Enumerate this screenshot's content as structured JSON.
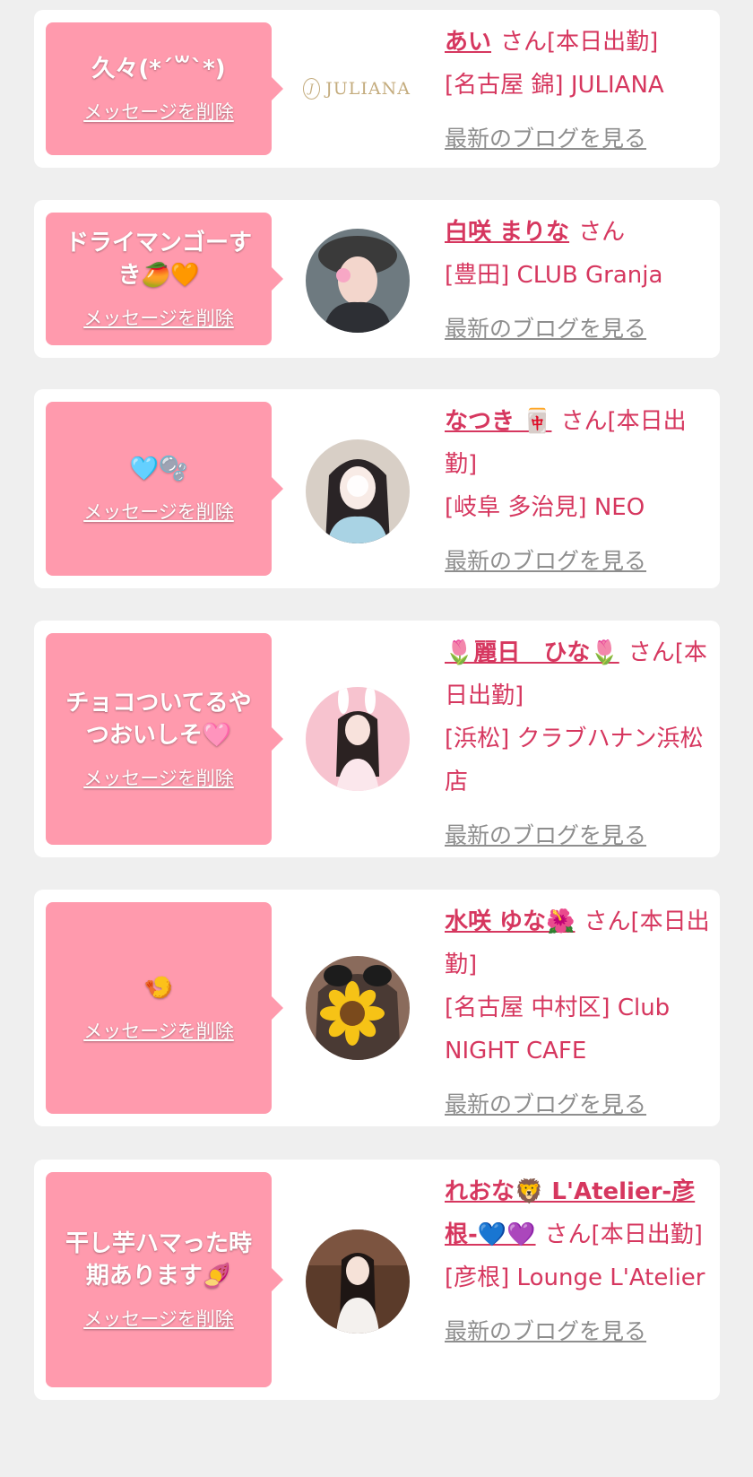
{
  "delete_label": "メッセージを削除",
  "blog_label": "最新のブログを見る",
  "colors": {
    "bubble": "#ff9aad",
    "accent": "#d6375f",
    "muted": "#8e8e8e",
    "page_bg": "#efefef"
  },
  "entries": [
    {
      "message": "久々(*´꒳`*)",
      "name": "あい",
      "suffix": "さん[本日出勤]",
      "store": "[名古屋 錦] JULIANA",
      "avatar": {
        "kind": "logo",
        "text": "JULIANA"
      }
    },
    {
      "message": "ドライマンゴーすき🥭🧡",
      "name": "白咲 まりな",
      "suffix": "さん",
      "store": "[豊田] CLUB Granja",
      "avatar": {
        "kind": "photo",
        "icon": "portrait-photo"
      }
    },
    {
      "message": "🩵🫧",
      "name": "なつき 🀄",
      "suffix": "さん[本日出勤]",
      "store": "[岐阜 多治見] NEO",
      "avatar": {
        "kind": "photo",
        "icon": "portrait-photo"
      }
    },
    {
      "message": "チョコついてるやつおいしそ🩷",
      "name": "🌷麗日　ひな🌷",
      "suffix": "さん[本日出勤]",
      "store": "[浜松] クラブハナン浜松店",
      "avatar": {
        "kind": "photo",
        "icon": "portrait-photo"
      }
    },
    {
      "message": "🍤 ",
      "name": "水咲 ゆな🌺",
      "suffix": "さん[本日出勤]",
      "store": "[名古屋 中村区] Club NIGHT CAFE",
      "avatar": {
        "kind": "photo",
        "icon": "sunflower-face-photo"
      }
    },
    {
      "message": "干し芋ハマった時期あります🍠",
      "name": "れおな🦁 L'Atelier-彦根-💙💜",
      "suffix": "さん[本日出勤]",
      "store": "[彦根] Lounge L'Atelier",
      "avatar": {
        "kind": "photo",
        "icon": "portrait-photo"
      }
    }
  ]
}
